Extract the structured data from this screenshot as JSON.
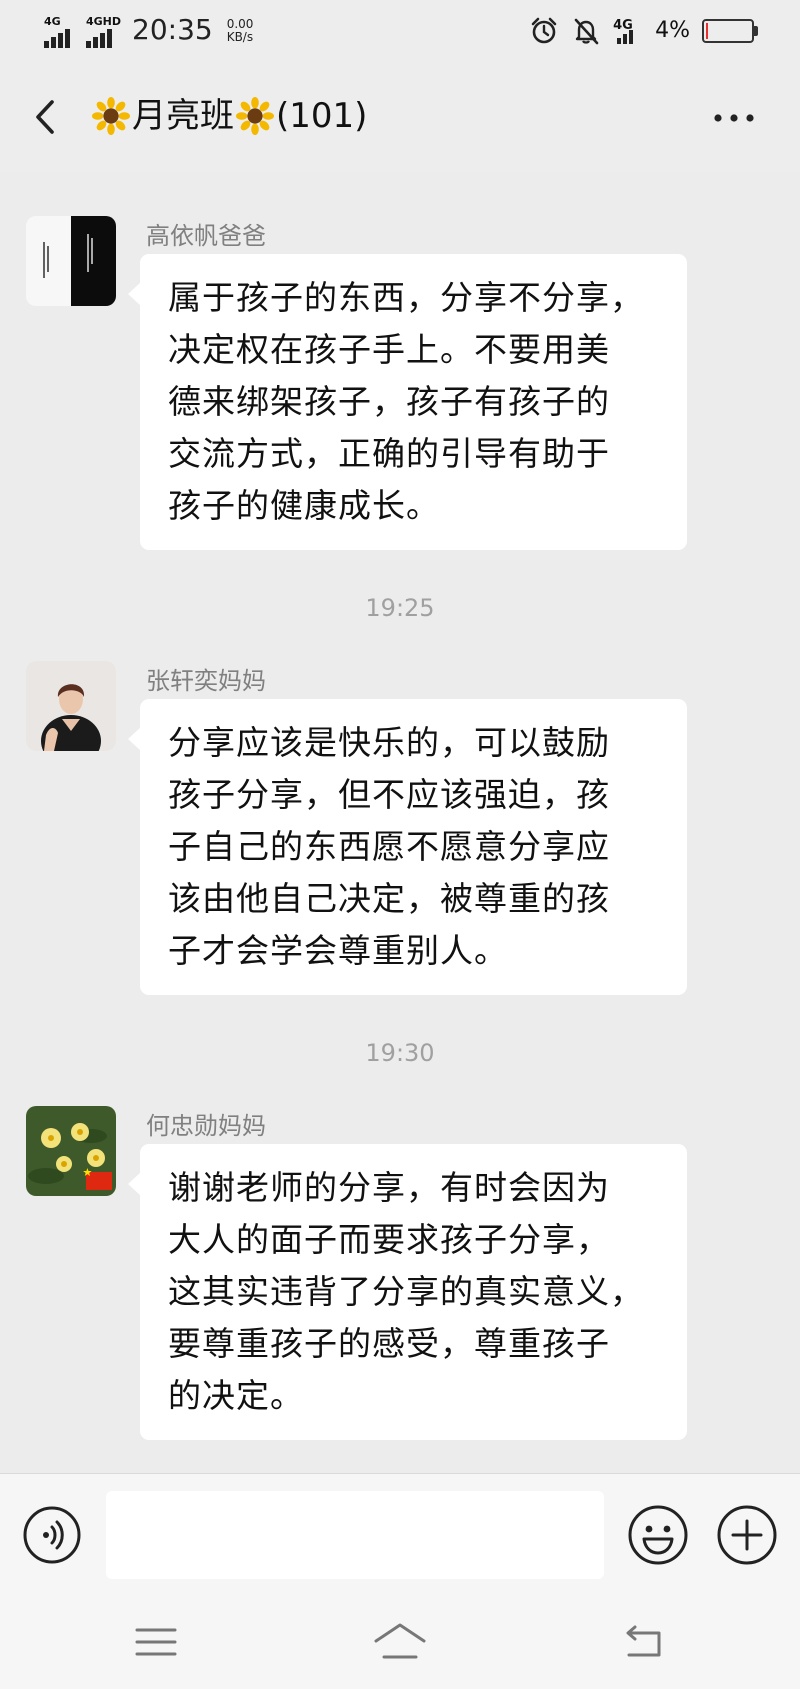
{
  "status_bar": {
    "network_1": "4G",
    "network_2": "4GHD",
    "time": "20:35",
    "speed_value": "0.00",
    "speed_unit": "KB/s",
    "network_3": "4G",
    "battery_percent": "4%",
    "battery_level": 0.04,
    "battery_color": "#ea2f2f",
    "icons": [
      "alarm-icon",
      "mute-bell-icon",
      "signal-4g-icon",
      "battery-icon"
    ]
  },
  "header": {
    "title": "月亮班",
    "member_count": "(101)",
    "back_icon": "chevron-left-icon",
    "more_icon": "more-dots-icon",
    "title_emoji": "sunflower-icon"
  },
  "messages": [
    {
      "sender": "高依帆爸爸",
      "text": "属于孩子的东西，分享不分享，\n决定权在孩子手上。不要用美\n德来绑架孩子，孩子有孩子的\n交流方式，正确的引导有助于\n孩子的健康成长。",
      "avatar": "calligraphy-avatar"
    },
    {
      "time_separator": "19:25",
      "sender": "张轩奕妈妈",
      "text": "分享应该是快乐的，可以鼓励\n孩子分享，但不应该强迫，孩\n子自己的东西愿不愿意分享应\n该由他自己决定，被尊重的孩\n子才会学会尊重别人。",
      "avatar": "portrait-avatar"
    },
    {
      "time_separator": "19:30",
      "sender": "何忠勋妈妈",
      "text": "谢谢老师的分享，有时会因为\n大人的面子而要求孩子分享，\n这其实违背了分享的真实意义，\n要尊重孩子的感受，尊重孩子\n的决定。",
      "avatar": "flowers-avatar"
    }
  ],
  "input_bar": {
    "value": "",
    "voice_icon": "voice-icon",
    "emoji_icon": "emoji-icon",
    "plus_icon": "plus-icon"
  },
  "system_nav": {
    "menu_icon": "menu-icon",
    "home_icon": "home-icon",
    "back_icon": "back-arrow-icon"
  },
  "colors": {
    "background": "#ececec",
    "bubble": "#ffffff",
    "timestamp": "#a0a0a0",
    "sender_name": "#808080"
  }
}
